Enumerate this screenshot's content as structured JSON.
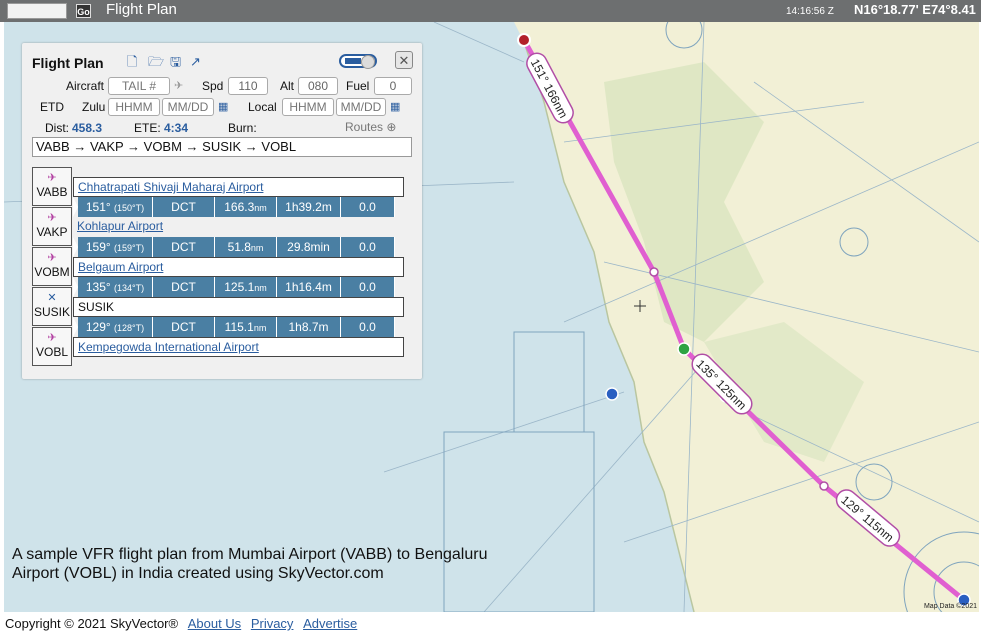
{
  "topbar": {
    "go_label": "Go",
    "title": "Flight Plan",
    "time": "14:16:56 Z",
    "coords": "N16°18.77' E74°8.41"
  },
  "map": {
    "credit": "Map Data ©2021",
    "route_labels": [
      "151° 166nm",
      "135° 125nm",
      "129° 115nm"
    ]
  },
  "flight_plan": {
    "title": "Flight Plan",
    "close_label": "✕",
    "aircraft_label": "Aircraft",
    "aircraft_placeholder": "TAIL #",
    "spd_label": "Spd",
    "spd_value": "110",
    "alt_label": "Alt",
    "alt_value": "080",
    "fuel_label": "Fuel",
    "fuel_value": "0",
    "etd_label": "ETD",
    "zulu_label": "Zulu",
    "zulu_time_placeholder": "HHMM",
    "zulu_date_placeholder": "MM/DD",
    "local_label": "Local",
    "local_time_placeholder": "HHMM",
    "local_date_placeholder": "MM/DD",
    "dist_label": "Dist:",
    "dist_value": "458.3",
    "ete_label": "ETE:",
    "ete_value": "4:34",
    "burn_label": "Burn:",
    "routes_label": "Routes",
    "route_string": "VABB → VAKP → VOBM → SUSIK → VOBL",
    "waypoints": [
      {
        "id": "VABB",
        "name": "Chhatrapati Shivaji Maharaj Airport",
        "type": "airport-icon"
      },
      {
        "id": "VAKP",
        "name": "Kohlapur Airport",
        "type": "airport-icon"
      },
      {
        "id": "VOBM",
        "name": "Belgaum Airport",
        "type": "airport-icon"
      },
      {
        "id": "SUSIK",
        "name": "SUSIK",
        "type": "fix-icon"
      },
      {
        "id": "VOBL",
        "name": "Kempegowda International Airport",
        "type": "airport-icon"
      }
    ],
    "legs": [
      {
        "course": "151°",
        "true_course": "(150°T)",
        "via": "DCT",
        "dist": "166.3",
        "dist_unit": "nm",
        "time": "1h39.2m",
        "fuel": "0.0"
      },
      {
        "course": "159°",
        "true_course": "(159°T)",
        "via": "DCT",
        "dist": "51.8",
        "dist_unit": "nm",
        "time": "29.8min",
        "fuel": "0.0"
      },
      {
        "course": "135°",
        "true_course": "(134°T)",
        "via": "DCT",
        "dist": "125.1",
        "dist_unit": "nm",
        "time": "1h16.4m",
        "fuel": "0.0"
      },
      {
        "course": "129°",
        "true_course": "(128°T)",
        "via": "DCT",
        "dist": "115.1",
        "dist_unit": "nm",
        "time": "1h8.7m",
        "fuel": "0.0"
      }
    ]
  },
  "caption": "A sample VFR flight plan from Mumbai Airport (VABB) to Bengaluru Airport (VOBL) in India created using SkyVector.com",
  "footer": {
    "copyright": "Copyright © 2021 SkyVector®",
    "links": [
      "About Us",
      "Privacy",
      "Advertise"
    ]
  },
  "colors": {
    "route": "#e05fd0",
    "panel_bg": "#f0f0f0",
    "leg_bg": "#4a7fa3",
    "land": "#f2f0d6",
    "sea": "#cfe3ea",
    "accent": "#2a5d9f"
  }
}
